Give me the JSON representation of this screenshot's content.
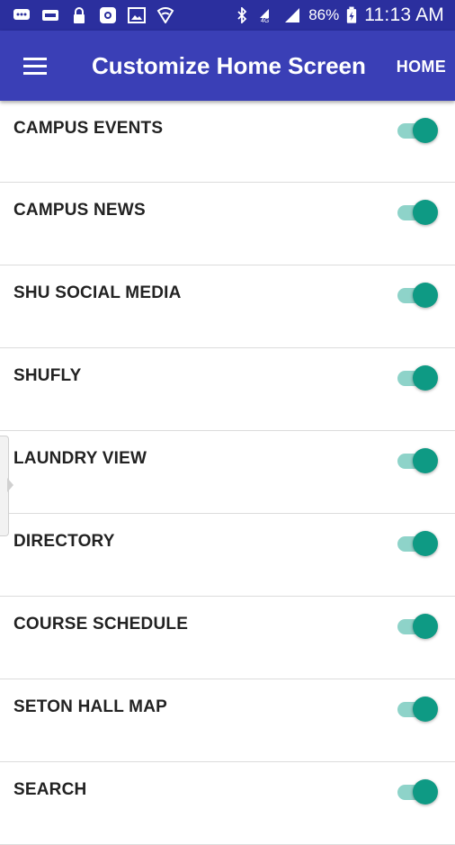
{
  "status_bar": {
    "battery": "86%",
    "time": "11:13 AM",
    "icons": [
      "message-icon",
      "voicemail-icon",
      "lock-icon",
      "instagram-icon",
      "image-icon",
      "wifi-hotspot-icon",
      "bluetooth-icon",
      "data-signal-icon",
      "cell-signal-icon",
      "battery-charging-icon"
    ]
  },
  "app_bar": {
    "title": "Customize Home Screen",
    "action": "HOME",
    "color": "#3a3fb6"
  },
  "items": [
    {
      "label": "CAMPUS EVENTS",
      "enabled": true
    },
    {
      "label": "CAMPUS NEWS",
      "enabled": true
    },
    {
      "label": "SHU SOCIAL MEDIA",
      "enabled": true
    },
    {
      "label": "SHUFLY",
      "enabled": true
    },
    {
      "label": "LAUNDRY VIEW",
      "enabled": true
    },
    {
      "label": "DIRECTORY",
      "enabled": true
    },
    {
      "label": "COURSE SCHEDULE",
      "enabled": true
    },
    {
      "label": "SETON HALL MAP",
      "enabled": true
    },
    {
      "label": "SEARCH",
      "enabled": true
    }
  ],
  "toggle_color": "#0e9a84"
}
